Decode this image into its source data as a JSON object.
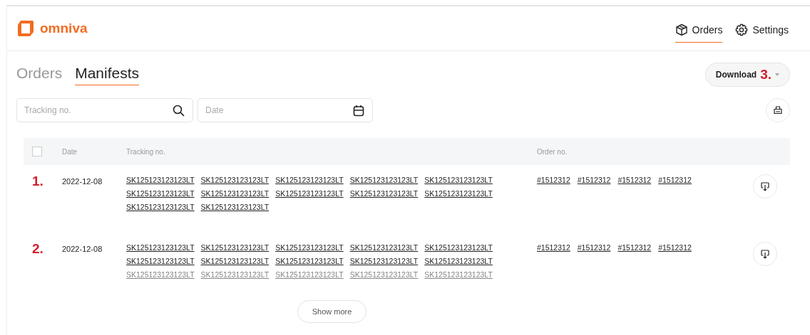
{
  "header": {
    "logo": "omniva",
    "nav": [
      {
        "label": "Orders",
        "selected": true
      },
      {
        "label": "Settings",
        "selected": false
      }
    ]
  },
  "tabs": [
    {
      "label": "Orders",
      "selected": false
    },
    {
      "label": "Manifests",
      "selected": true
    }
  ],
  "download_button": {
    "label": "Download",
    "annotation": "3."
  },
  "filters": {
    "tracking": {
      "placeholder": "Tracking no."
    },
    "date": {
      "placeholder": "Date"
    }
  },
  "table": {
    "header_checkbox": {
      "checked": false
    },
    "columns": [
      "Date",
      "Tracking no.",
      "Order no."
    ],
    "rows": [
      {
        "marker": "1.",
        "date": "2022-12-08",
        "truncated": false,
        "tracking": [
          "SK125123123123LT",
          "SK125123123123LT",
          "SK125123123123LT",
          "SK125123123123LT",
          "SK125123123123LT",
          "SK125123123123LT",
          "SK125123123123LT",
          "SK125123123123LT",
          "SK125123123123LT",
          "SK125123123123LT",
          "SK125123123123LT",
          "SK125123123123LT"
        ],
        "orders": [
          "#1512312",
          "#1512312",
          "#1512312",
          "#1512312"
        ]
      },
      {
        "marker": "2.",
        "date": "2022-12-08",
        "truncated": true,
        "tracking": [
          "SK125123123123LT",
          "SK125123123123LT",
          "SK125123123123LT",
          "SK125123123123LT",
          "SK125123123123LT",
          "SK125123123123LT",
          "SK125123123123LT",
          "SK125123123123LT",
          "SK125123123123LT",
          "SK125123123123LT",
          "SK125123123123LT",
          "SK125123123123LT",
          "SK125123123123LT",
          "SK125123123123LT",
          "SK125123123123LT"
        ],
        "orders": [
          "#1512312",
          "#1512312",
          "#1512312",
          "#1512312"
        ]
      }
    ],
    "show_more": "Show more"
  }
}
